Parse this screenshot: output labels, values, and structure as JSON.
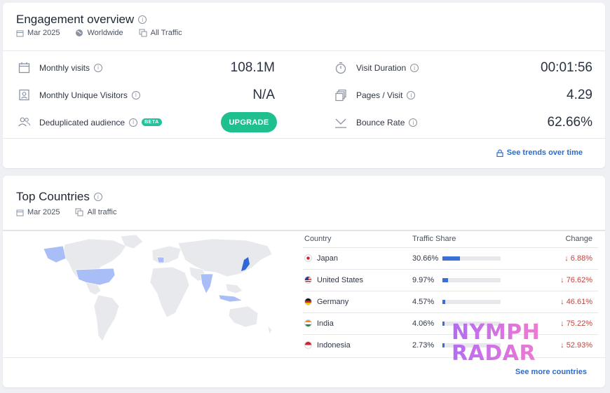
{
  "engagement": {
    "title": "Engagement overview",
    "date": "Mar 2025",
    "region": "Worldwide",
    "traffic": "All Traffic",
    "metrics_left": [
      {
        "label": "Monthly visits",
        "value": "108.1M",
        "icon": "calendar-icon"
      },
      {
        "label": "Monthly Unique Visitors",
        "value": "N/A",
        "icon": "id-card-icon"
      },
      {
        "label": "Deduplicated audience",
        "badge": "BETA",
        "icon": "people-icon"
      }
    ],
    "upgrade_label": "UPGRADE",
    "metrics_right": [
      {
        "label": "Visit Duration",
        "value": "00:01:56",
        "icon": "stopwatch-icon"
      },
      {
        "label": "Pages / Visit",
        "value": "4.29",
        "icon": "pages-icon"
      },
      {
        "label": "Bounce Rate",
        "value": "62.66%",
        "icon": "trend-icon"
      }
    ],
    "trends_link": "See trends over time"
  },
  "countries": {
    "title": "Top Countries",
    "date": "Mar 2025",
    "traffic": "All traffic",
    "headers": {
      "country": "Country",
      "share": "Traffic Share",
      "change": "Change"
    },
    "rows": [
      {
        "name": "Japan",
        "share": "30.66%",
        "share_frac": 0.3066,
        "change": "6.88%",
        "flag": "jp"
      },
      {
        "name": "United States",
        "share": "9.97%",
        "share_frac": 0.0997,
        "change": "76.62%",
        "flag": "us"
      },
      {
        "name": "Germany",
        "share": "4.57%",
        "share_frac": 0.0457,
        "change": "46.61%",
        "flag": "de"
      },
      {
        "name": "India",
        "share": "4.06%",
        "share_frac": 0.0406,
        "change": "75.22%",
        "flag": "in"
      },
      {
        "name": "Indonesia",
        "share": "2.73%",
        "share_frac": 0.0273,
        "change": "52.93%",
        "flag": "id"
      }
    ],
    "more_link": "See more countries"
  },
  "watermark": {
    "line1": "NYMPH",
    "line2": "RADAR"
  },
  "colors": {
    "accent": "#1fbf8f",
    "link": "#2c6cc7",
    "bar": "#3c6fd6",
    "negative": "#c4423b",
    "map_highlight": "#a9bdf7"
  }
}
